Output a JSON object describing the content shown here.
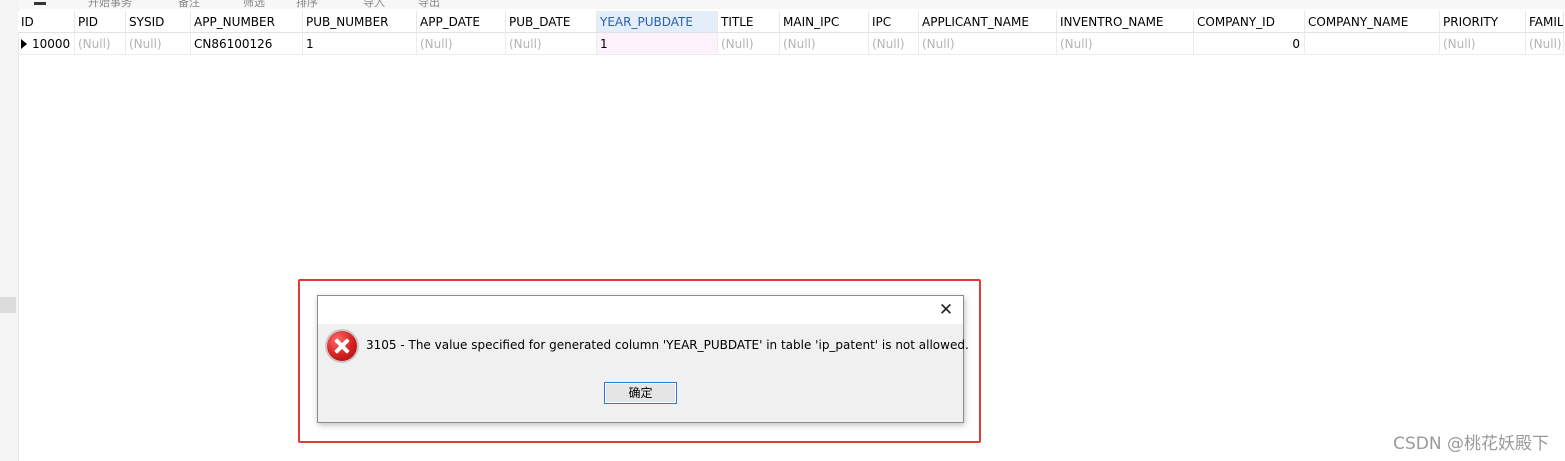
{
  "toolbar": {
    "begin_transaction": "开始事务",
    "memo": "备注",
    "filter": "筛选",
    "sort": "排序",
    "import": "导入",
    "export": "导出"
  },
  "table": {
    "columns": [
      "ID",
      "PID",
      "SYSID",
      "APP_NUMBER",
      "PUB_NUMBER",
      "APP_DATE",
      "PUB_DATE",
      "YEAR_PUBDATE",
      "TITLE",
      "MAIN_IPC",
      "IPC",
      "APPLICANT_NAME",
      "INVENTRO_NAME",
      "COMPANY_ID",
      "COMPANY_NAME",
      "PRIORITY",
      "FAMIL"
    ],
    "selected_column": "YEAR_PUBDATE",
    "rows": [
      [
        "10000",
        "(Null)",
        "(Null)",
        "CN86100126",
        "1",
        "(Null)",
        "(Null)",
        "1",
        "(Null)",
        "(Null)",
        "(Null)",
        "(Null)",
        "(Null)",
        "0",
        "",
        "(Null)",
        "(Null)"
      ]
    ]
  },
  "dialog": {
    "message": "3105 - The value specified for generated column 'YEAR_PUBDATE' in table 'ip_patent' is not allowed.",
    "ok_label": "确定",
    "close_glyph": "✕",
    "icon": "error-icon"
  },
  "watermark": "CSDN @桃花妖殿下",
  "colors": {
    "highlight_border": "#e53935",
    "selected_header": "#e3eefa",
    "null_text": "#b4b4b4"
  }
}
